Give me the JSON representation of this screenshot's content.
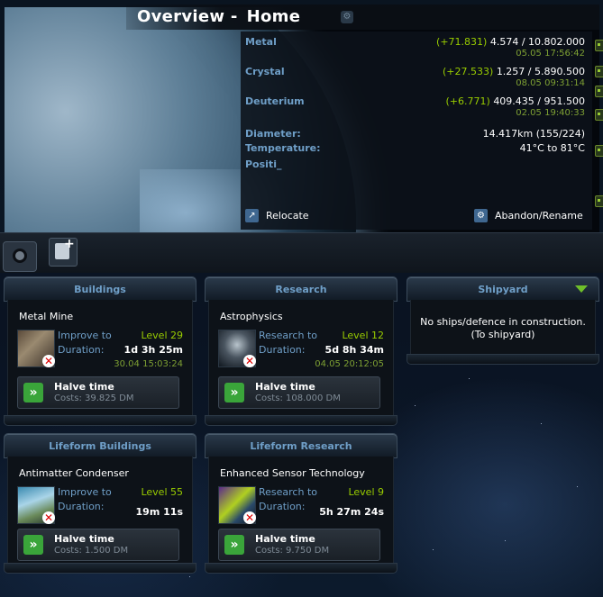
{
  "header": {
    "overview_label": "Overview -",
    "planet_name": "Home",
    "resources": [
      {
        "name": "Metal",
        "delta": "(+71.831)",
        "amount": "4.574 / 10.802.000",
        "time": "05.05 17:56:42"
      },
      {
        "name": "Crystal",
        "delta": "(+27.533)",
        "amount": "1.257 / 5.890.500",
        "time": "08.05 09:31:14"
      },
      {
        "name": "Deuterium",
        "delta": "(+6.771)",
        "amount": "409.435 / 951.500",
        "time": "02.05 19:40:33"
      }
    ],
    "details": [
      {
        "label": "Diameter:",
        "value": "14.417km (155/224)"
      },
      {
        "label": "Temperature:",
        "value": "41°C to 81°C"
      },
      {
        "label": "Positi_",
        "value": ""
      }
    ],
    "actions": {
      "relocate": "Relocate",
      "abandon": "Abandon/Rename"
    }
  },
  "boxes": {
    "buildings": {
      "title": "Buildings",
      "item": "Metal Mine",
      "label1": "Improve to",
      "label2": "Duration:",
      "level": "Level 29",
      "duration": "1d 3h 25m",
      "done": "30.04 15:03:24",
      "halve": "Halve time",
      "cost": "Costs: 39.825 DM"
    },
    "research": {
      "title": "Research",
      "item": "Astrophysics",
      "label1": "Research to",
      "label2": "Duration:",
      "level": "Level 12",
      "duration": "5d 8h 34m",
      "done": "04.05 20:12:05",
      "halve": "Halve time",
      "cost": "Costs: 108.000 DM"
    },
    "shipyard": {
      "title": "Shipyard",
      "msg1": "No ships/defence in construction.",
      "msg2": "(To shipyard)"
    },
    "lf_buildings": {
      "title": "Lifeform Buildings",
      "item": "Antimatter Condenser",
      "label1": "Improve to",
      "label2": "Duration:",
      "level": "Level 55",
      "duration": "19m 11s",
      "halve": "Halve time",
      "cost": "Costs: 1.500 DM"
    },
    "lf_research": {
      "title": "Lifeform Research",
      "item": "Enhanced Sensor Technology",
      "label1": "Research to",
      "label2": "Duration:",
      "level": "Level 9",
      "duration": "5h 27m 24s",
      "halve": "Halve time",
      "cost": "Costs: 9.750 DM"
    }
  },
  "icons": {
    "gear": "gear-icon",
    "relocate": "relocate-icon",
    "abandon": "gear-icon",
    "moon": "moon-icon",
    "add_planet": "add-planet-icon",
    "cancel": "cancel-icon",
    "halve": "halve-time-icon"
  },
  "colors": {
    "label_blue": "#6f9fc8",
    "accent_green": "#99cc00",
    "cancel_red": "#dd0000"
  }
}
